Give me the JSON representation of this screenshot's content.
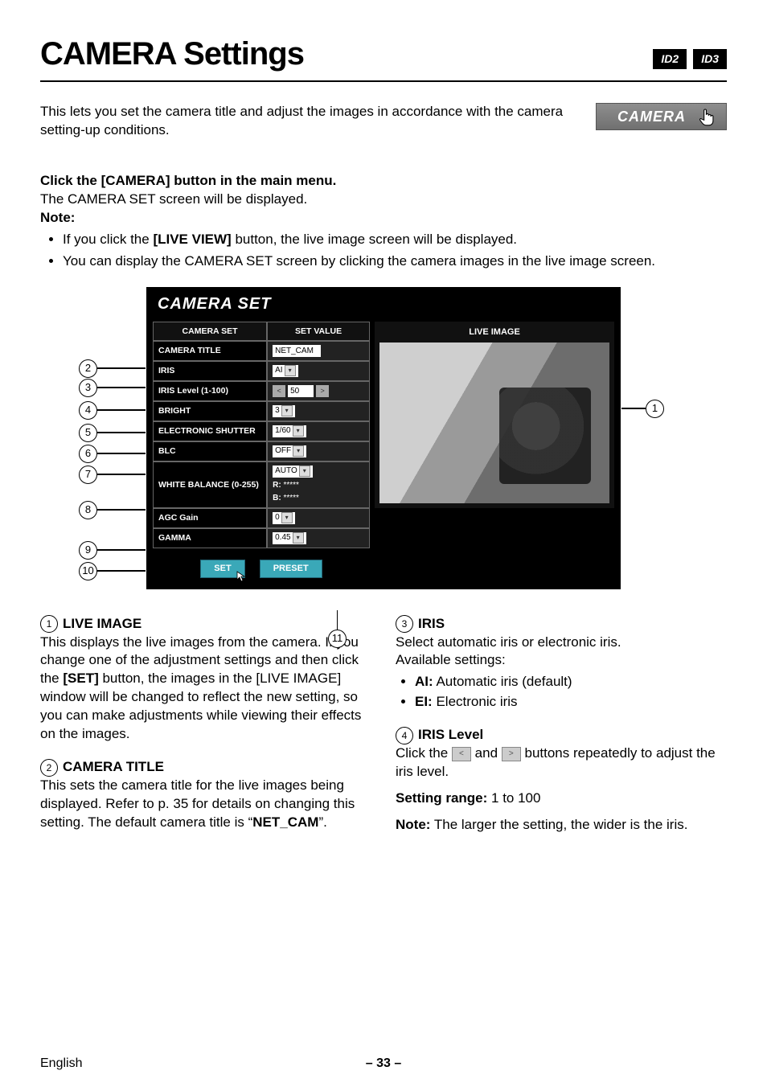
{
  "header": {
    "title": "CAMERA Settings",
    "badges": [
      "ID2",
      "ID3"
    ]
  },
  "intro": "This lets you set the camera title and adjust the images in accordance with the camera setting-up conditions.",
  "cameraButton": {
    "label": "CAMERA"
  },
  "instruction": {
    "click_line_prefix": "Click the ",
    "click_line_bold": "[CAMERA]",
    "click_line_suffix": " button in the main menu.",
    "screen_line": "The CAMERA SET screen will be displayed.",
    "note_label": "Note:",
    "notes_prefix1": "If you click the ",
    "notes_bold1": "[LIVE VIEW]",
    "notes_suffix1": " button, the live image screen will be displayed.",
    "notes_full2": "You can display the CAMERA SET screen by clicking the camera images in the live image screen."
  },
  "screenshot": {
    "window_title": "CAMERA SET",
    "col_label": "CAMERA SET",
    "col_value": "SET VALUE",
    "rows": {
      "camera_title": {
        "label": "CAMERA TITLE",
        "value": "NET_CAM"
      },
      "iris": {
        "label": "IRIS",
        "value": "AI"
      },
      "iris_level": {
        "label": "IRIS Level (1-100)",
        "value": "50"
      },
      "bright": {
        "label": "BRIGHT",
        "value": "3"
      },
      "shutter": {
        "label": "ELECTRONIC SHUTTER",
        "value": "1/60"
      },
      "blc": {
        "label": "BLC",
        "value": "OFF"
      },
      "wb": {
        "label": "WHITE BALANCE (0-255)",
        "mode": "AUTO",
        "r_label": "R:",
        "r": "*****",
        "b_label": "B:",
        "b": "*****"
      },
      "agc": {
        "label": "AGC Gain",
        "value": "0"
      },
      "gamma": {
        "label": "GAMMA",
        "value": "0.45"
      }
    },
    "buttons": {
      "set": "SET",
      "preset": "PRESET"
    },
    "live_head": "LIVE IMAGE"
  },
  "sections": {
    "s1": {
      "num": "1",
      "title": "LIVE IMAGE",
      "body_pre": "This displays the live images from the camera. If you change one of the adjustment settings and then click the ",
      "body_bold": "[SET]",
      "body_post": " button, the images in the [LIVE IMAGE] window will be changed to reflect the new setting, so you can make adjustments while viewing their effects on the images."
    },
    "s2": {
      "num": "2",
      "title": "CAMERA TITLE",
      "body_pre": "This sets the camera title for the live images being displayed. Refer to p. 35 for details on changing this setting.  The default camera title is “",
      "body_bold": "NET_CAM",
      "body_post": "”."
    },
    "s3": {
      "num": "3",
      "title": "IRIS",
      "lead1": "Select automatic iris or electronic iris.",
      "lead2": "Available settings:",
      "opt1_label": "AI:",
      "opt1_text": " Automatic iris (default)",
      "opt2_label": "EI:",
      "opt2_text": " Electronic iris"
    },
    "s4": {
      "num": "4",
      "title": "IRIS Level",
      "body_pre": "Click the ",
      "body_mid": " and ",
      "body_post": " buttons repeatedly to adjust the iris level.",
      "range_label": "Setting range:",
      "range_value": " 1 to 100",
      "note_label": "Note:",
      "note_text": " The larger the setting, the wider is the iris."
    }
  },
  "footer": {
    "lang": "English",
    "page": "– 33 –"
  }
}
